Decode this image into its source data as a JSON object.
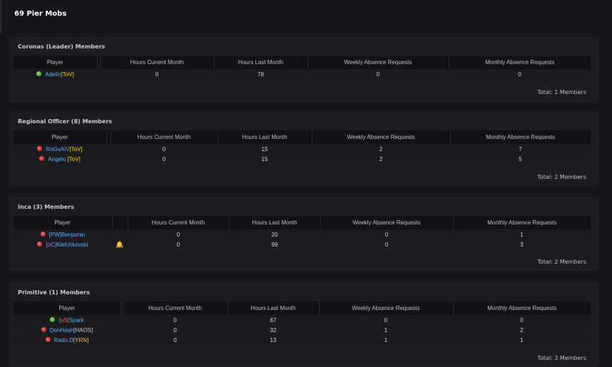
{
  "page": {
    "title": "69 Pier Mobs"
  },
  "headers": {
    "player": "Player",
    "hours_current": "Hours Current Month",
    "hours_last": "Hours Last Month",
    "weekly": "Weekly Absence Requests",
    "monthly": "Monthly Absence Requests"
  },
  "groups": [
    {
      "title": "Coronas (Leader) Members",
      "total": "Total: 1 Members",
      "members": [
        {
          "status": "green",
          "name": "Adelin",
          "tag": "[ToV]",
          "tag_position": "after",
          "tag_color": "yellow",
          "hours_current": "0",
          "hours_last": "78",
          "weekly": "0",
          "monthly": "0"
        }
      ]
    },
    {
      "title": "Regional Officer (8) Members",
      "total": "Total: 2 Members",
      "members": [
        {
          "status": "red",
          "name": "RoGvAiV",
          "tag": "[ToV]",
          "tag_position": "after",
          "tag_color": "yellow",
          "hours_current": "0",
          "hours_last": "15",
          "weekly": "2",
          "monthly": "7"
        },
        {
          "status": "red",
          "name": "Angelo.",
          "tag": "[ToV]",
          "tag_position": "after",
          "tag_color": "yellow",
          "hours_current": "0",
          "hours_last": "15",
          "weekly": "2",
          "monthly": "5"
        }
      ]
    },
    {
      "title": "Inca (3) Members",
      "total": "Total: 2 Members",
      "members": [
        {
          "status": "red",
          "name": "Benjamin",
          "tag": "[PW]",
          "tag_position": "before",
          "tag_color": "blue",
          "hours_current": "0",
          "hours_last": "20",
          "weekly": "0",
          "monthly": "1"
        },
        {
          "status": "red",
          "name": "Klefchkovski",
          "tag": "[oC]",
          "tag_position": "before",
          "tag_color": "purple",
          "hours_current": "0",
          "hours_last": "99",
          "weekly": "0",
          "monthly": "3",
          "bell": true
        }
      ]
    },
    {
      "title": "Primitive (1) Members",
      "total": "Total: 3 Members",
      "members": [
        {
          "status": "green",
          "name": "Spark",
          "tag": "[uS]",
          "tag_position": "before",
          "tag_color": "red",
          "hours_current": "0",
          "hours_last": "67",
          "weekly": "0",
          "monthly": "0"
        },
        {
          "status": "red",
          "name": "DonHash",
          "tag": "[HAOS]",
          "tag_position": "after",
          "tag_color": "gray",
          "hours_current": "0",
          "hours_last": "32",
          "weekly": "1",
          "monthly": "2"
        },
        {
          "status": "red",
          "name": "Radu.D",
          "tag": "[YRN]",
          "tag_position": "after",
          "tag_color": "orange",
          "hours_current": "0",
          "hours_last": "13",
          "weekly": "1",
          "monthly": "1"
        }
      ]
    }
  ]
}
